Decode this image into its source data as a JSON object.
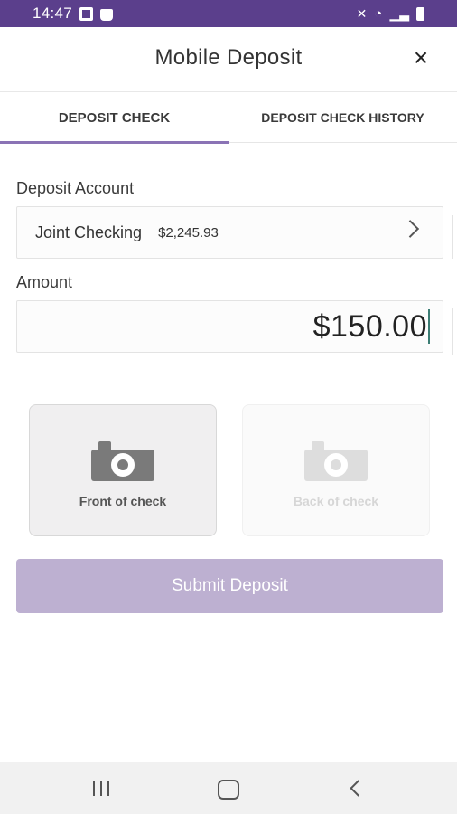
{
  "status_bar": {
    "time": "14:47",
    "icons": [
      "app-square-icon",
      "shopping-bag-icon",
      "mute-icon",
      "wifi-icon",
      "signal-icon",
      "battery-icon"
    ],
    "bg_color": "#5b3f8c"
  },
  "header": {
    "title": "Mobile Deposit",
    "close_icon": "×"
  },
  "tabs": [
    {
      "label": "DEPOSIT CHECK",
      "active": true
    },
    {
      "label": "DEPOSIT CHECK HISTORY",
      "active": false
    }
  ],
  "deposit_account": {
    "label": "Deposit Account",
    "account_name": "Joint Checking",
    "balance": "$2,245.93"
  },
  "amount": {
    "label": "Amount",
    "value": "$150.00"
  },
  "photos": {
    "front_label": "Front of check",
    "back_label": "Back of check"
  },
  "submit": {
    "label": "Submit Deposit",
    "color": "#bdb0d1"
  },
  "accent_color": "#8a73b5"
}
